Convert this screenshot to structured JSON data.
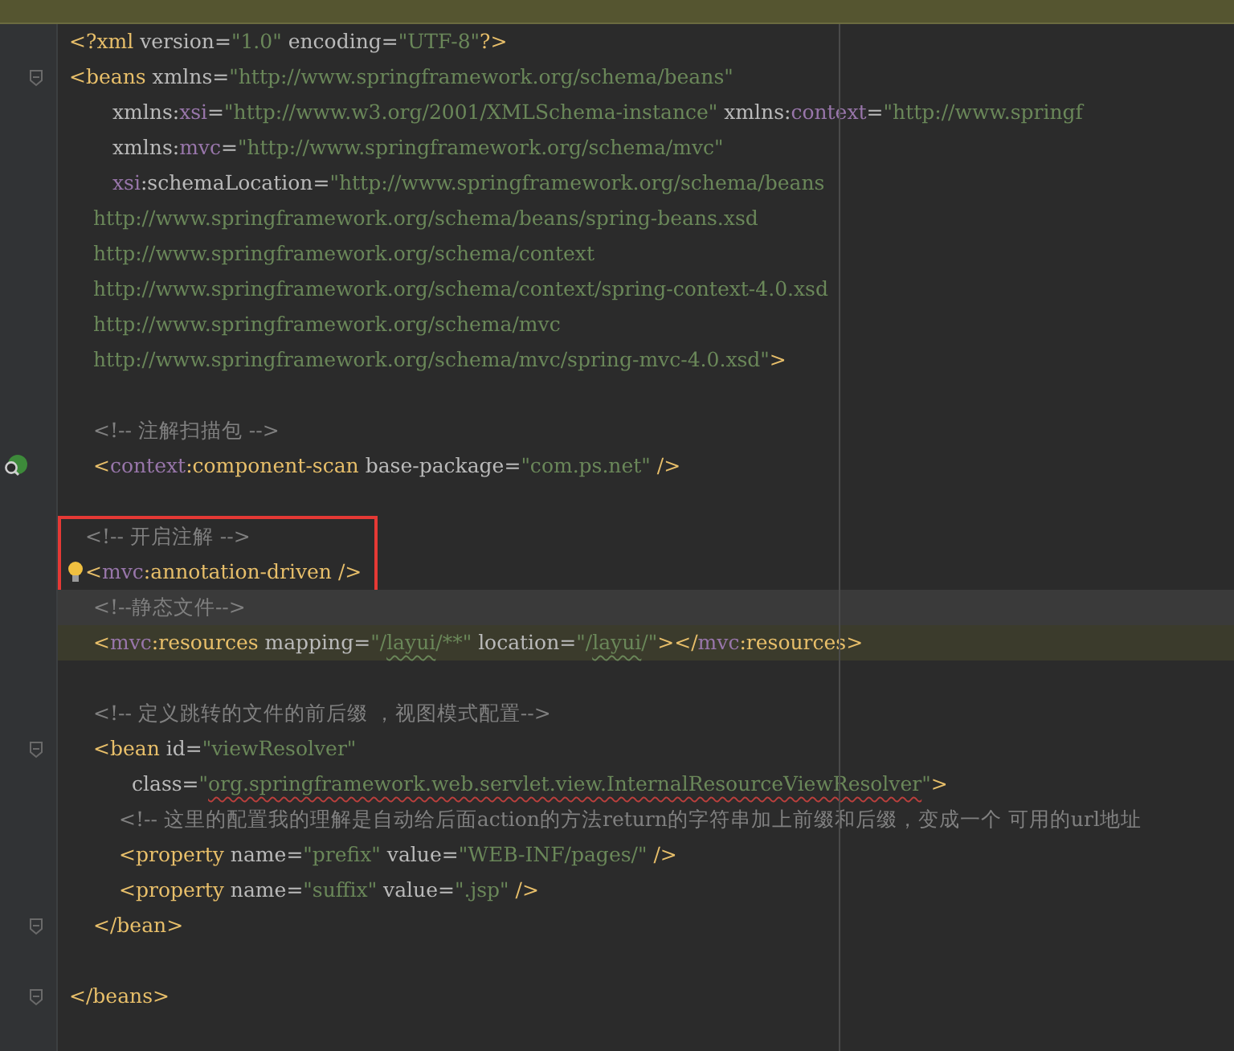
{
  "notice_bar": {
    "kind": "notice"
  },
  "editor": {
    "lines": [
      {
        "kind": "root",
        "tokens": [
          {
            "kind": "tag",
            "t": "<?"
          },
          {
            "kind": "name",
            "t": "xml "
          },
          {
            "kind": "attr",
            "t": "version"
          },
          {
            "kind": "eq",
            "t": "="
          },
          {
            "kind": "value",
            "t": "\"1.0\" "
          },
          {
            "kind": "attr",
            "t": "encoding"
          },
          {
            "kind": "eq",
            "t": "="
          },
          {
            "kind": "value",
            "t": "\"UTF-8\""
          },
          {
            "kind": "tag",
            "t": "?>"
          }
        ]
      },
      {
        "kind": "root",
        "foldable": true,
        "tokens": [
          {
            "kind": "tag",
            "t": "<beans "
          },
          {
            "kind": "attr",
            "t": "xmlns"
          },
          {
            "kind": "eq",
            "t": "="
          },
          {
            "kind": "value",
            "t": "\"http://www.springframework.org/schema/beans\""
          }
        ]
      },
      {
        "kind": "attribute",
        "tokens": [
          {
            "kind": "attr",
            "t": "xmlns:"
          },
          {
            "kind": "ns",
            "t": "xsi"
          },
          {
            "kind": "eq",
            "t": "="
          },
          {
            "kind": "value",
            "t": "\"http://www.w3.org/2001/XMLSchema-instance\" "
          },
          {
            "kind": "attr",
            "t": "xmlns:"
          },
          {
            "kind": "ns",
            "t": "context"
          },
          {
            "kind": "eq",
            "t": "="
          },
          {
            "kind": "value",
            "t": "\"http://www.springf"
          }
        ]
      },
      {
        "kind": "attribute",
        "tokens": [
          {
            "kind": "attr",
            "t": "xmlns:"
          },
          {
            "kind": "ns",
            "t": "mvc"
          },
          {
            "kind": "eq",
            "t": "="
          },
          {
            "kind": "value",
            "t": "\"http://www.springframework.org/schema/mvc\""
          }
        ]
      },
      {
        "kind": "attribute",
        "tokens": [
          {
            "kind": "ns",
            "t": "xsi"
          },
          {
            "kind": "attr",
            "t": ":schemaLocation"
          },
          {
            "kind": "eq",
            "t": "="
          },
          {
            "kind": "value",
            "t": "\"http://www.springframework.org/schema/beans"
          }
        ]
      },
      {
        "kind": "child",
        "tokens": [
          {
            "kind": "value",
            "t": "http://www.springframework.org/schema/beans/spring-beans.xsd"
          }
        ]
      },
      {
        "kind": "child",
        "tokens": [
          {
            "kind": "value",
            "t": "http://www.springframework.org/schema/context"
          }
        ]
      },
      {
        "kind": "child",
        "tokens": [
          {
            "kind": "value",
            "t": "http://www.springframework.org/schema/context/spring-context-4.0.xsd"
          }
        ]
      },
      {
        "kind": "child",
        "tokens": [
          {
            "kind": "value",
            "t": "http://www.springframework.org/schema/mvc"
          }
        ]
      },
      {
        "kind": "child",
        "tokens": [
          {
            "kind": "value",
            "t": "http://www.springframework.org/schema/mvc/spring-mvc-4.0.xsd\""
          },
          {
            "kind": "tag",
            "t": ">"
          }
        ]
      },
      {
        "kind": "blank"
      },
      {
        "kind": "child",
        "tokens": [
          {
            "kind": "comment",
            "t": "<!-- 注解扫描包 -->"
          }
        ]
      },
      {
        "kind": "child",
        "bean_marker": true,
        "tokens": [
          {
            "kind": "tag",
            "t": "<"
          },
          {
            "kind": "ns",
            "t": "context"
          },
          {
            "kind": "tag",
            "t": ":component-scan "
          },
          {
            "kind": "attr",
            "t": "base-package"
          },
          {
            "kind": "eq",
            "t": "="
          },
          {
            "kind": "value",
            "t": "\"com.ps.net\" "
          },
          {
            "kind": "tag",
            "t": "/>"
          }
        ]
      },
      {
        "kind": "blank"
      },
      {
        "kind": "child",
        "framed": true,
        "tokens": [
          {
            "kind": "comment",
            "t": "<!-- 开启注解 -->"
          }
        ]
      },
      {
        "kind": "child",
        "framed": true,
        "bulb": true,
        "tokens": [
          {
            "kind": "tag",
            "t": "<"
          },
          {
            "kind": "ns",
            "t": "mvc"
          },
          {
            "kind": "tag",
            "t": ":annotation-driven />"
          }
        ]
      },
      {
        "kind": "child",
        "current": true,
        "tokens": [
          {
            "kind": "comment",
            "t": "<!--静态文件-->"
          }
        ]
      },
      {
        "kind": "child",
        "highlighted": true,
        "tokens": [
          {
            "kind": "tag",
            "t": "<"
          },
          {
            "kind": "ns",
            "t": "mvc"
          },
          {
            "kind": "tag",
            "t": ":resources "
          },
          {
            "kind": "attr",
            "t": "mapping"
          },
          {
            "kind": "eq",
            "t": "="
          },
          {
            "kind": "value",
            "t": "\"/"
          },
          {
            "kind": "value",
            "t": "layui",
            "typo": true
          },
          {
            "kind": "value",
            "t": "/**\" "
          },
          {
            "kind": "attr",
            "t": "location"
          },
          {
            "kind": "eq",
            "t": "="
          },
          {
            "kind": "value",
            "t": "\"/"
          },
          {
            "kind": "value",
            "t": "layui",
            "typo": true
          },
          {
            "kind": "value",
            "t": "/\""
          },
          {
            "kind": "tag",
            "t": "></"
          },
          {
            "kind": "ns",
            "t": "mvc"
          },
          {
            "kind": "tag",
            "t": ":resources>"
          }
        ]
      },
      {
        "kind": "blank"
      },
      {
        "kind": "child",
        "tokens": [
          {
            "kind": "comment",
            "t": "<!-- 定义跳转的文件的前后缀 ，视图模式配置-->"
          }
        ]
      },
      {
        "kind": "child",
        "foldable": true,
        "tokens": [
          {
            "kind": "tag",
            "t": "<bean "
          },
          {
            "kind": "attr",
            "t": "id"
          },
          {
            "kind": "eq",
            "t": "="
          },
          {
            "kind": "value",
            "t": "\"viewResolver\""
          }
        ]
      },
      {
        "kind": "nested_attribute",
        "tokens": [
          {
            "kind": "attr",
            "t": "class"
          },
          {
            "kind": "eq",
            "t": "="
          },
          {
            "kind": "value",
            "t": "\""
          },
          {
            "kind": "value",
            "t": "org.springframework.web.servlet.view.InternalResourceViewResolver",
            "error": true
          },
          {
            "kind": "value",
            "t": "\""
          },
          {
            "kind": "tag",
            "t": ">"
          }
        ]
      },
      {
        "kind": "nested",
        "tokens": [
          {
            "kind": "comment",
            "t": "<!-- 这里的配置我的理解是自动给后面action的方法return的字符串加上前缀和后缀，变成一个 可用的url地址"
          }
        ]
      },
      {
        "kind": "nested",
        "tokens": [
          {
            "kind": "tag",
            "t": "<property "
          },
          {
            "kind": "attr",
            "t": "name"
          },
          {
            "kind": "eq",
            "t": "="
          },
          {
            "kind": "value",
            "t": "\"prefix\" "
          },
          {
            "kind": "attr",
            "t": "value"
          },
          {
            "kind": "eq",
            "t": "="
          },
          {
            "kind": "value",
            "t": "\"WEB-INF/pages/\" "
          },
          {
            "kind": "tag",
            "t": "/>"
          }
        ]
      },
      {
        "kind": "nested",
        "tokens": [
          {
            "kind": "tag",
            "t": "<property "
          },
          {
            "kind": "attr",
            "t": "name"
          },
          {
            "kind": "eq",
            "t": "="
          },
          {
            "kind": "value",
            "t": "\"suffix\" "
          },
          {
            "kind": "attr",
            "t": "value"
          },
          {
            "kind": "eq",
            "t": "="
          },
          {
            "kind": "value",
            "t": "\".jsp\" "
          },
          {
            "kind": "tag",
            "t": "/>"
          }
        ]
      },
      {
        "kind": "child",
        "foldable": true,
        "tokens": [
          {
            "kind": "tag",
            "t": "</bean>"
          }
        ]
      },
      {
        "kind": "blank"
      },
      {
        "kind": "root",
        "foldable": true,
        "tokens": [
          {
            "kind": "tag",
            "t": "</beans>"
          }
        ]
      }
    ]
  }
}
